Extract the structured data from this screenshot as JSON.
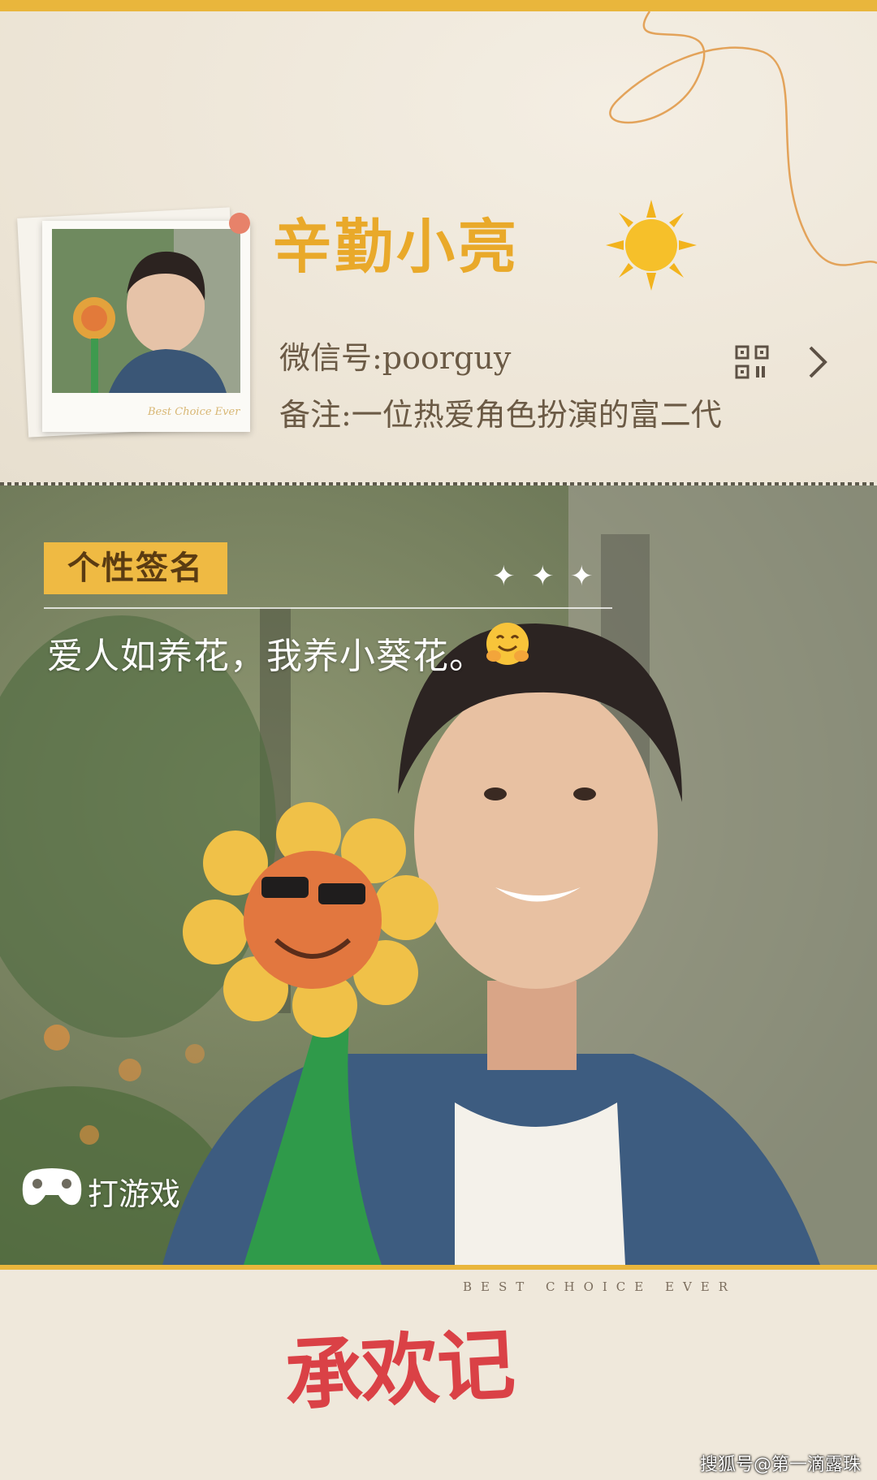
{
  "profile": {
    "nickname": "辛勤小亮",
    "wechat_id": "微信号:poorguy",
    "remark": "备注:一位热爱角色扮演的富二代",
    "polaroid_caption": "Best Choice Ever"
  },
  "signature": {
    "label": "个性签名",
    "text": "爱人如养花，我养小葵花。"
  },
  "status": {
    "label": "打游戏"
  },
  "footer": {
    "tagline": "BEST  CHOICE  EVER",
    "show_title": "承欢记",
    "watermark": "搜狐号@第一滴露珠"
  },
  "icons": {
    "sun": "sun-icon",
    "qr": "qr-code-icon",
    "chevron": "chevron-right-icon",
    "sparkles": "sparkle-icon",
    "hug": "hugging-face-emoji-icon",
    "game": "gamepad-icon"
  },
  "colors": {
    "accent": "#e9b63c",
    "nickname": "#e9a92a",
    "label_bg": "#efba43",
    "title_red": "#d9333a",
    "text_brown": "#6b5a45"
  }
}
